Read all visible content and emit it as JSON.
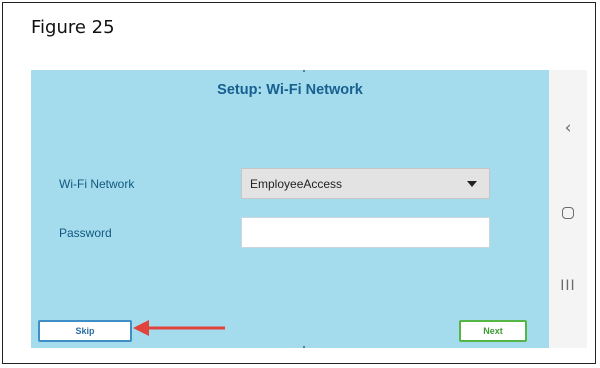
{
  "figure": {
    "caption": "Figure 25"
  },
  "setup": {
    "title": "Setup: Wi-Fi Network",
    "wifi": {
      "label": "Wi-Fi Network",
      "selected": "EmployeeAccess"
    },
    "password": {
      "label": "Password",
      "value": ""
    },
    "buttons": {
      "skip": "Skip",
      "next": "Next"
    }
  },
  "navbar": {
    "back": "‹",
    "recent": "III"
  },
  "colors": {
    "screen_bg": "#a4dcee",
    "title": "#17608f",
    "skip_border": "#3f8fc6",
    "next_border": "#55b545",
    "arrow": "#e0443a"
  },
  "icons": [
    "back-icon",
    "home-icon",
    "recent-apps-icon",
    "dropdown-caret-icon",
    "arrow-icon"
  ]
}
